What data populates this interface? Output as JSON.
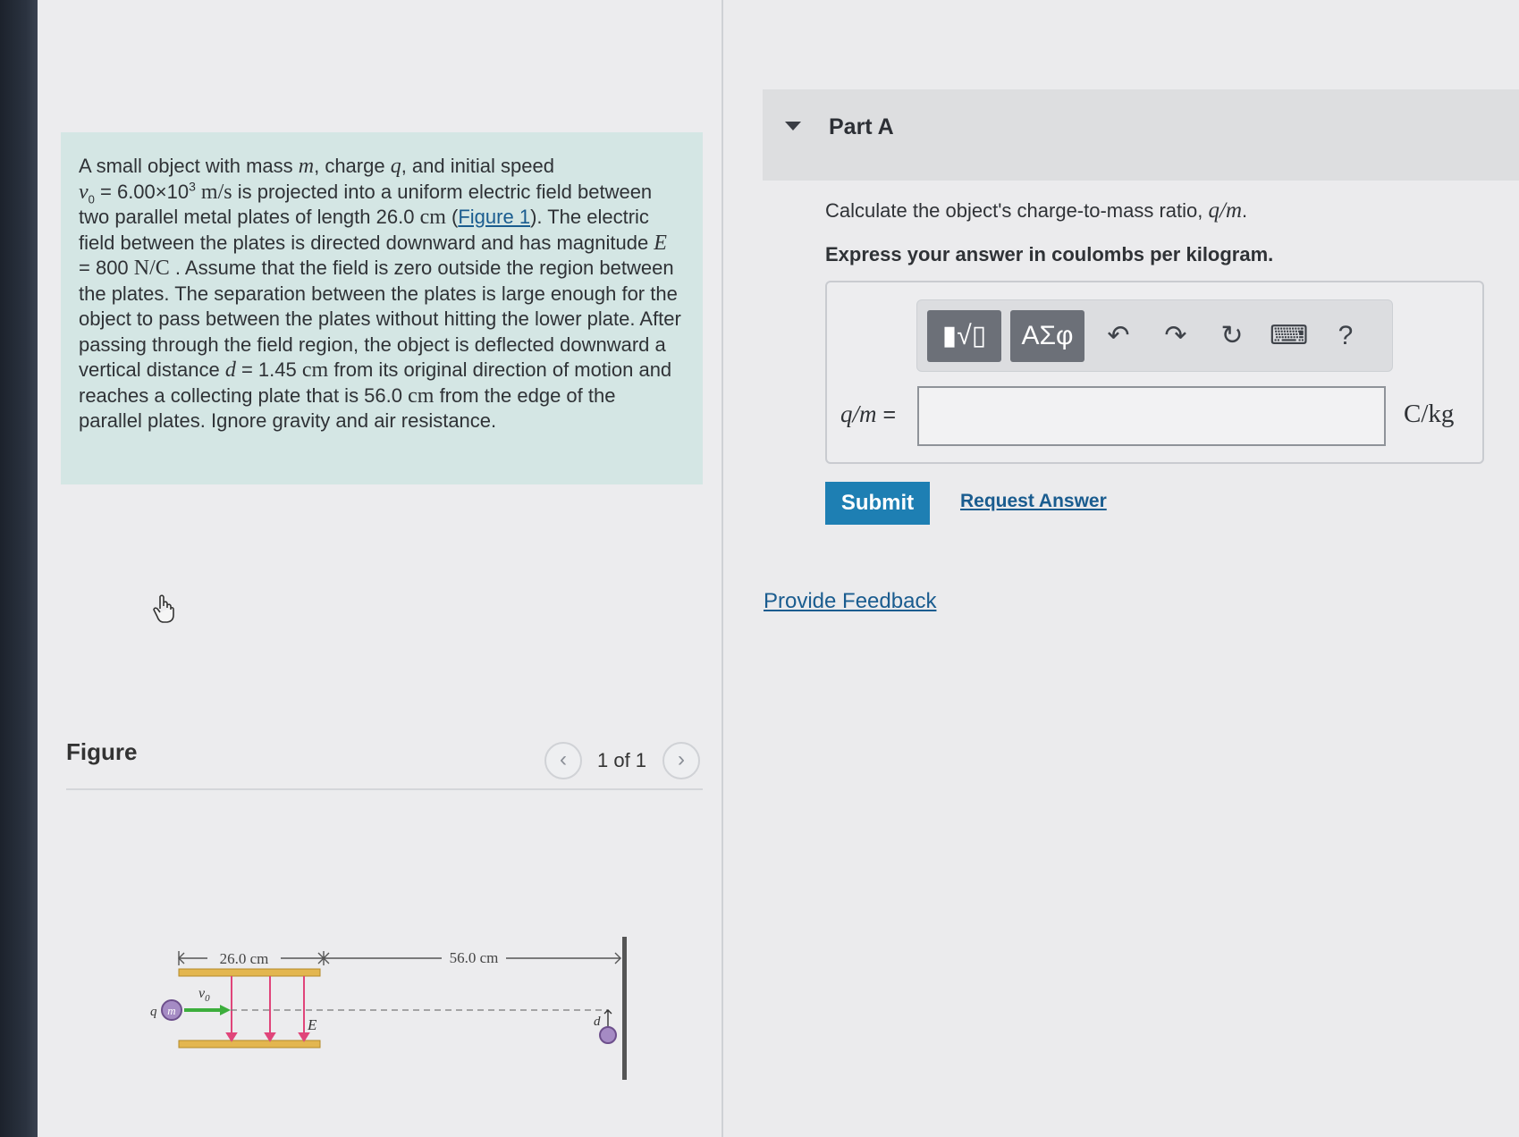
{
  "problem": {
    "p1": "A small object with mass ",
    "m": "m",
    "p2": ", charge ",
    "q": "q",
    "p3": ", and initial speed",
    "v0_sym": "v",
    "v0_sub": "0",
    "p4": " = 6.00×10",
    "exp": "3",
    "unit_ms": " m/s",
    "p5": " is projected into a uniform electric field between two parallel metal plates of length 26.0 ",
    "unit_cm1": "cm",
    "p6": " (",
    "figure_link": "Figure 1",
    "p7": "). The electric field between the plates is directed downward and has magnitude ",
    "E": "E",
    "p8": " = 800 ",
    "unit_NC": "N/C",
    "p9": " . Assume that the field is zero outside the region between the plates. The separation between the plates is large enough for the object to pass between the plates without hitting the lower plate. After passing through the field region, the object is deflected downward a vertical distance ",
    "d": "d",
    "p10": " = 1.45 ",
    "unit_cm2": "cm",
    "p11": " from its original direction of motion and reaches a collecting plate that is 56.0 ",
    "unit_cm3": "cm",
    "p12": " from the edge of the parallel plates. Ignore gravity and air resistance."
  },
  "figure": {
    "title": "Figure",
    "counter": "1 of 1",
    "prev": "‹",
    "next": "›",
    "dim1": "26.0 cm",
    "dim2": "56.0 cm",
    "q_label": "q",
    "m_label": "m",
    "v0_label": "v",
    "v0_sub": "0",
    "E_label": "E",
    "d_label": "d"
  },
  "part": {
    "title": "Part A",
    "question_pre": "Calculate the object's charge-to-mass ratio, ",
    "question_math": "q/m",
    "question_post": ".",
    "instruction": "Express your answer in coulombs per kilogram.",
    "toolbar": {
      "templates": "▮√▯",
      "greek": "ΑΣφ",
      "undo": "↶",
      "redo": "↷",
      "reset": "↻",
      "keyboard": "⌨",
      "help": "?"
    },
    "answer_label_math": "q/m",
    "answer_label_eq": " =",
    "answer_value": "",
    "unit": "C/kg",
    "submit": "Submit",
    "request": "Request Answer"
  },
  "feedback": "Provide Feedback",
  "colors": {
    "problem_bg": "#d4e6e4",
    "submit_bg": "#1e7fb3",
    "link": "#1a5c8f",
    "plate": "#e3b64f",
    "field_arrow": "#e0457a",
    "velocity_arrow": "#3cae3c",
    "charge": "#8a5aa0"
  }
}
